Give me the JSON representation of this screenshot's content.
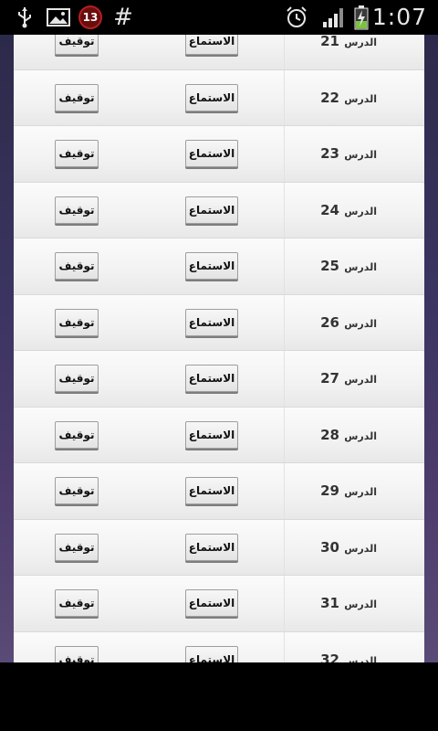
{
  "status_bar": {
    "notification_count": "13",
    "hash": "#",
    "time": "1:07",
    "icons": [
      "usb-icon",
      "image-icon",
      "alarm-icon",
      "signal-icon",
      "battery-charging-icon"
    ]
  },
  "lessons": {
    "listen_label": "الاستماع",
    "stop_label": "توقيف",
    "lesson_word": "الدرس",
    "items": [
      {
        "number": "21"
      },
      {
        "number": "22"
      },
      {
        "number": "23"
      },
      {
        "number": "24"
      },
      {
        "number": "25"
      },
      {
        "number": "26"
      },
      {
        "number": "27"
      },
      {
        "number": "28"
      },
      {
        "number": "29"
      },
      {
        "number": "30"
      },
      {
        "number": "31"
      },
      {
        "number": "32"
      }
    ]
  },
  "colors": {
    "row_background": "#f2f2f2",
    "status_bar": "#000000",
    "badge": "#6b0d0d"
  }
}
